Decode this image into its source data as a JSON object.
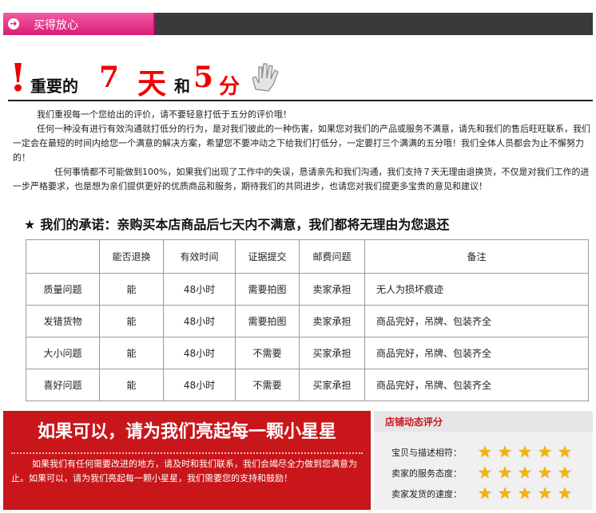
{
  "header": {
    "label": "买得放心",
    "icon": "arrow-right-circle-icon"
  },
  "title": {
    "excl": "!",
    "part1": "重要的",
    "seven": "7",
    "tian": "天",
    "he": "和",
    "five": "5",
    "fen": "分",
    "icon": "hand-icon"
  },
  "paragraphs": {
    "p1": "我们重视每一个您给出的评价，请不要轻意打低于五分的评价哦！",
    "p2": "任何一种没有进行有效沟通就打低分的行为，是对我们彼此的一种伤害，如果您对我们的产品或服务不满意，请先和我们的售后旺旺联系，我们一定会在最短的时间内给您一个满意的解决方案，希望您不要冲动之下给我们打低分，一定要打三个满满的五分哦！我们全体人员都会为止不懈努力的！",
    "p3": "任何事情都不可能做到100%，如果我们出现了工作中的失误，恳请亲先和我们沟通，我们支持７天无理由退换货，不仅是对我们工作的进一步严格要求，也是想为亲们提供更好的优质商品和服务，期待我们的共同进步，也请您对我们提更多宝贵的意见和建议！"
  },
  "promise": {
    "star": "★",
    "text": "我们的承诺：亲购买本店商品后七天内不满意，我们都将无理由为您退还"
  },
  "table": {
    "headers": [
      "",
      "能否退换",
      "有效时间",
      "证据提交",
      "邮费问题",
      "备注"
    ],
    "rows": [
      [
        "质量问题",
        "能",
        "48小时",
        "需要拍图",
        "卖家承担",
        "无人为损坏痕迹"
      ],
      [
        "发错货物",
        "能",
        "48小时",
        "需要拍图",
        "卖家承担",
        "商品完好，吊牌、包装齐全"
      ],
      [
        "大小问题",
        "能",
        "48小时",
        "不需要",
        "买家承担",
        "商品完好，吊牌、包装齐全"
      ],
      [
        "喜好问题",
        "能",
        "48小时",
        "不需要",
        "买家承担",
        "商品完好，吊牌、包装齐全"
      ]
    ]
  },
  "bottom": {
    "big": "如果可以，请为我们亮起每一颗小星星",
    "small": "如果我们有任何需要改进的地方，请及时和我们联系，我们会竭尽全力做到您满意为止。如果可以，请为我们亮起每一颗小星星，我们需要您的支持和鼓励！"
  },
  "rating": {
    "title": "店铺动态评分",
    "rows": [
      {
        "label": "宝贝与描述相符：",
        "stars": 5
      },
      {
        "label": "卖家的服务态度：",
        "stars": 5
      },
      {
        "label": "卖家发货的速度：",
        "stars": 5
      }
    ],
    "star_color": "#f4b400"
  }
}
